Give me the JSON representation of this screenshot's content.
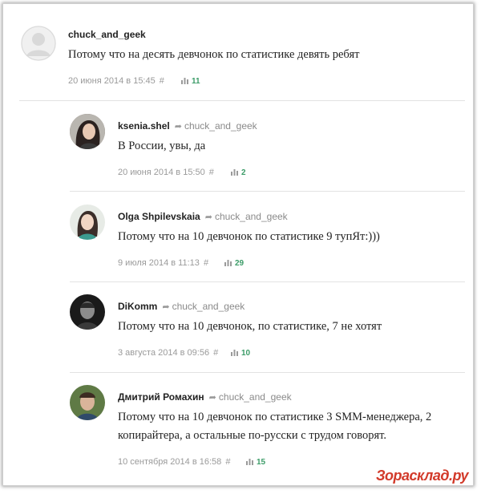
{
  "comments": [
    {
      "author": "chuck_and_geek",
      "reply_to": "",
      "text": "Потому что на десять девчонок по статистике девять ребят",
      "date": "20 июня 2014 в 15:45",
      "votes": "11"
    },
    {
      "author": "ksenia.shel",
      "reply_to": "chuck_and_geek",
      "text": "В России, увы, да",
      "date": "20 июня 2014 в 15:50",
      "votes": "2"
    },
    {
      "author": "Olga Shpilevskaia",
      "reply_to": "chuck_and_geek",
      "text": "Потому что на 10 девчонок по статистике 9 тупЯт:)))",
      "date": "9 июля 2014 в 11:13",
      "votes": "29"
    },
    {
      "author": "DiKomm",
      "reply_to": "chuck_and_geek",
      "text": "Потому что на 10 девчонок, по статистике, 7 не хотят",
      "date": "3 августа 2014 в 09:56",
      "votes": "10"
    },
    {
      "author": "Дмитрий Ромахин",
      "reply_to": "chuck_and_geek",
      "text_line1": "Потому что на 10 девчонок по статистике 3 SMM-менеджера, 2",
      "text_line2": "копирайтера, а остальные по-русски с трудом говорят.",
      "date": "10 сентября 2014 в 16:58",
      "votes": "15"
    }
  ],
  "hash_symbol": "#",
  "watermark": "Зорасклад.ру",
  "colors": {
    "votes": "#3c9c68",
    "meta": "#9a9a9a",
    "watermark": "#d23a2a"
  }
}
